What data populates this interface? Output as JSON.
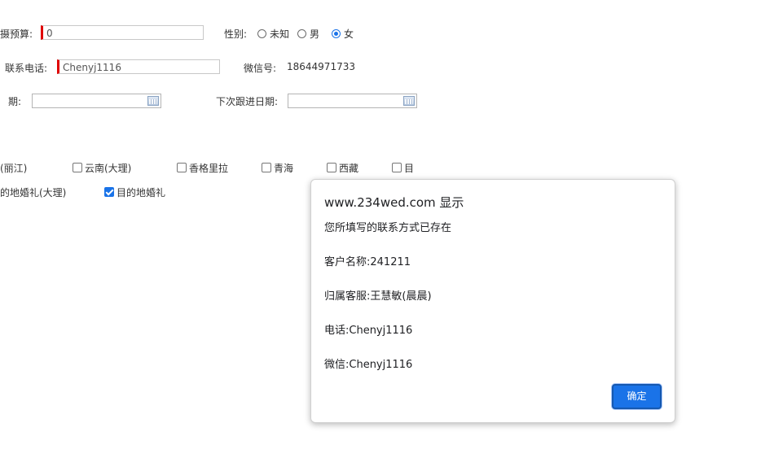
{
  "form": {
    "budget": {
      "label": "摄预算:",
      "value": "0"
    },
    "gender": {
      "label": "性别:",
      "options": [
        "未知",
        "男",
        "女"
      ],
      "selected": "女"
    },
    "phone": {
      "label": "联系电话:",
      "value": "Chenyj1116"
    },
    "wechat": {
      "label": "微信号:",
      "value": "18644971733"
    },
    "date1": {
      "label": "期:",
      "value": ""
    },
    "next_followup": {
      "label": "下次跟进日期:",
      "value": ""
    },
    "destinations_row1": [
      {
        "label": "(丽江)",
        "checked": false,
        "has_box": false
      },
      {
        "label": "云南(大理)",
        "checked": false,
        "has_box": true
      },
      {
        "label": "香格里拉",
        "checked": false,
        "has_box": true
      },
      {
        "label": "青海",
        "checked": false,
        "has_box": true
      },
      {
        "label": "西藏",
        "checked": false,
        "has_box": true
      },
      {
        "label": "目",
        "checked": false,
        "has_box": true
      }
    ],
    "destinations_row2": [
      {
        "label": "的地婚礼(大理)",
        "checked": false,
        "has_box": false
      },
      {
        "label": "目的地婚礼",
        "checked": true,
        "has_box": true
      }
    ]
  },
  "dialog": {
    "title": "www.234wed.com 显示",
    "message": "您所填写的联系方式已存在",
    "customer_name": "客户名称:241211",
    "owner": "归属客服:王慧敏(晨晨)",
    "phone": "电话:Chenyj1116",
    "wechat": "微信:Chenyj1116",
    "ok_label": "确定"
  },
  "colors": {
    "accent": "#1a73e8",
    "required_marker": "#e00000"
  }
}
